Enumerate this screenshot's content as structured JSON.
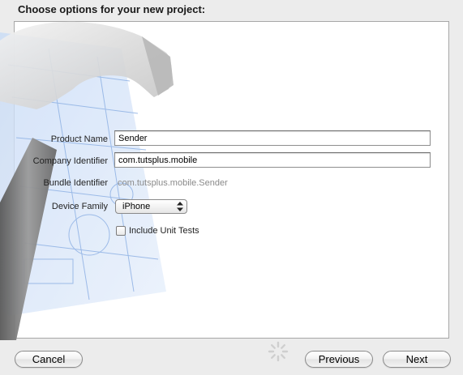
{
  "header": {
    "title": "Choose options for your new project:"
  },
  "form": {
    "product_name": {
      "label": "Product Name",
      "value": "Sender"
    },
    "company_identifier": {
      "label": "Company Identifier",
      "value": "com.tutsplus.mobile"
    },
    "bundle_identifier": {
      "label": "Bundle Identifier",
      "value": "com.tutsplus.mobile.Sender"
    },
    "device_family": {
      "label": "Device Family",
      "selected": "iPhone"
    },
    "unit_tests": {
      "label": "Include Unit Tests",
      "checked": false
    }
  },
  "buttons": {
    "cancel": "Cancel",
    "previous": "Previous",
    "next": "Next"
  },
  "artwork": {
    "icon": "hammer-blueprint-icon",
    "blueprint_color": "#4f86d8"
  }
}
